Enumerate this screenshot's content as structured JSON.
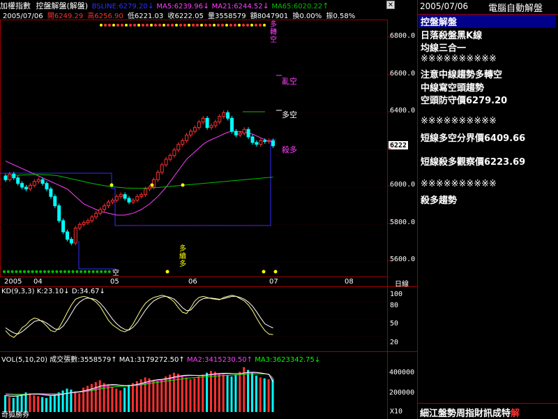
{
  "title": {
    "index_name": "加權指數",
    "mode": "控盤解盤(解盤)",
    "bsline_label": "BSLINE:6279.20",
    "ma5_label": "MA5:6239.96",
    "ma21_label": "MA21:6244.52",
    "ma65_label": "MA65:6020.22"
  },
  "info": {
    "date": "2005/07/06",
    "open": "開6249.29",
    "high": "高6256.90",
    "low": "低6221.03",
    "close": "收6222.05",
    "volume": "量3558579",
    "amount": "額8047901",
    "turnover": "換0.00%",
    "amplitude": "振0.58%"
  },
  "price_axis": {
    "ticks": [
      "6800.0",
      "6600.0",
      "6400.0",
      "6200.0",
      "6000.0",
      "5800.0",
      "5600.0"
    ],
    "current_price": "6222.0"
  },
  "time_axis": {
    "labels": [
      "2005",
      "04",
      "05",
      "06",
      "07",
      "08"
    ],
    "unit_button": "日線"
  },
  "annotations": {
    "bull_to_bear": "多轉空",
    "chaos_empty": "亂空",
    "bull_empty": "多空",
    "kill_bull": "殺多",
    "bull_holding": "多續多",
    "empty_mark": "空"
  },
  "kd": {
    "label": "KD(9,3,3)",
    "k_label": "K:23.10",
    "d_label": "D:34.67",
    "ticks": [
      "100",
      "80",
      "50",
      "20"
    ],
    "k_values": [
      30,
      22,
      18,
      25,
      35,
      40,
      48,
      52,
      50,
      45,
      38,
      30,
      28,
      35,
      48,
      62,
      75,
      85,
      88,
      90,
      88,
      85,
      80,
      72,
      60,
      48,
      40,
      35,
      30,
      28,
      32,
      42,
      55,
      68,
      78,
      84,
      88,
      90,
      92,
      90,
      86,
      80,
      70,
      62,
      60,
      70,
      82,
      88,
      90,
      88,
      86,
      85,
      84,
      88,
      90,
      92,
      90,
      86,
      82,
      75,
      65,
      52,
      40,
      30,
      24,
      23
    ],
    "d_values": [
      35,
      30,
      26,
      24,
      28,
      34,
      40,
      46,
      48,
      47,
      43,
      38,
      33,
      32,
      38,
      48,
      60,
      72,
      80,
      85,
      87,
      86,
      84,
      78,
      70,
      60,
      50,
      42,
      36,
      32,
      31,
      36,
      44,
      55,
      66,
      75,
      82,
      86,
      89,
      90,
      88,
      85,
      78,
      70,
      65,
      66,
      74,
      82,
      86,
      87,
      87,
      86,
      85,
      86,
      88,
      90,
      90,
      88,
      85,
      80,
      73,
      63,
      52,
      42,
      38,
      34.67
    ],
    "k_color": "#ffff80",
    "d_color": "#ffffff"
  },
  "volume": {
    "label": "VOL(5,10,20)",
    "shares_label": "成交張數:3558579",
    "ma1_label": "MA1:3179272.50",
    "ma2_label": "MA2:3415230.50",
    "ma3_label": "MA3:3623342.75",
    "ticks": [
      "400000",
      "200000"
    ],
    "multiplier": "X10",
    "values": [
      180000,
      160000,
      150000,
      170000,
      190000,
      210000,
      200000,
      180000,
      170000,
      160000,
      150000,
      170000,
      190000,
      210000,
      230000,
      250000,
      240000,
      220000,
      200000,
      260000,
      280000,
      300000,
      320000,
      340000,
      310000,
      290000,
      270000,
      250000,
      230000,
      260000,
      290000,
      310000,
      330000,
      350000,
      370000,
      360000,
      340000,
      330000,
      350000,
      380000,
      400000,
      420000,
      410000,
      390000,
      370000,
      350000,
      360000,
      380000,
      400000,
      420000,
      440000,
      430000,
      410000,
      400000,
      390000,
      380000,
      400000,
      430000,
      480000,
      450000,
      420000,
      390000,
      370000,
      360000,
      350000,
      356000
    ],
    "ma1": [
      175000,
      170000,
      168000,
      172000,
      178000,
      185000,
      190000,
      192000,
      190000,
      186000,
      180000,
      176000,
      178000,
      184000,
      192000,
      200000,
      208000,
      214000,
      218000,
      226000,
      236000,
      248000,
      262000,
      276000,
      286000,
      292000,
      294000,
      292000,
      286000,
      282000,
      282000,
      288000,
      296000,
      306000,
      318000,
      330000,
      340000,
      346000,
      350000,
      356000,
      364000,
      374000,
      384000,
      390000,
      394000,
      394000,
      392000,
      390000,
      392000,
      396000,
      402000,
      408000,
      412000,
      414000,
      414000,
      412000,
      410000,
      412000,
      418000,
      424000,
      426000,
      424000,
      418000,
      410000,
      400000,
      318000
    ],
    "ma2": [
      185000,
      182000,
      180000,
      180000,
      182000,
      186000,
      190000,
      192000,
      192000,
      190000,
      188000,
      186000,
      186000,
      188000,
      192000,
      198000,
      204000,
      210000,
      214000,
      220000,
      228000,
      238000,
      250000,
      262000,
      272000,
      280000,
      285000,
      287000,
      286000,
      284000,
      283000,
      285000,
      290000,
      298000,
      308000,
      318000,
      328000,
      336000,
      342000,
      348000,
      356000,
      364000,
      372000,
      380000,
      386000,
      390000,
      392000,
      392000,
      392000,
      394000,
      398000,
      402000,
      406000,
      408000,
      410000,
      410000,
      410000,
      410000,
      414000,
      418000,
      420000,
      420000,
      416000,
      410000,
      404000,
      341523
    ],
    "ma3": [
      195000,
      193000,
      191000,
      190000,
      190000,
      191000,
      193000,
      195000,
      196000,
      196000,
      195000,
      194000,
      194000,
      195000,
      197000,
      200000,
      204000,
      208000,
      212000,
      217000,
      223000,
      230000,
      238000,
      246000,
      254000,
      261000,
      267000,
      272000,
      275000,
      277000,
      279000,
      282000,
      286000,
      291000,
      297000,
      304000,
      311000,
      318000,
      324000,
      330000,
      336000,
      342000,
      348000,
      354000,
      360000,
      365000,
      369000,
      372000,
      375000,
      378000,
      381000,
      384000,
      387000,
      390000,
      393000,
      395000,
      397000,
      399000,
      402000,
      405000,
      407000,
      408000,
      408000,
      407000,
      405000,
      362334
    ]
  },
  "candles": {
    "opens": [
      6060,
      6040,
      6070,
      6050,
      6020,
      6000,
      5990,
      6010,
      6030,
      6040,
      6020,
      5990,
      5950,
      5900,
      5820,
      5760,
      5720,
      5700,
      5780,
      5800,
      5810,
      5820,
      5840,
      5860,
      5880,
      5900,
      5920,
      5930,
      5950,
      5960,
      5940,
      5920,
      5930,
      5950,
      5960,
      5990,
      6000,
      6040,
      6080,
      6120,
      6150,
      6170,
      6200,
      6230,
      6250,
      6280,
      6300,
      6320,
      6350,
      6370,
      6320,
      6330,
      6350,
      6380,
      6400,
      6370,
      6300,
      6280,
      6290,
      6310,
      6270,
      6240,
      6230,
      6250,
      6245,
      6249
    ],
    "closes": [
      6040,
      6070,
      6050,
      6020,
      6000,
      5990,
      6010,
      6030,
      6040,
      6020,
      5990,
      5950,
      5900,
      5820,
      5760,
      5720,
      5700,
      5780,
      5800,
      5810,
      5820,
      5840,
      5860,
      5880,
      5900,
      5920,
      5930,
      5950,
      5960,
      5940,
      5920,
      5930,
      5950,
      5960,
      5990,
      6000,
      6040,
      6080,
      6120,
      6150,
      6170,
      6200,
      6230,
      6250,
      6280,
      6300,
      6320,
      6350,
      6370,
      6320,
      6330,
      6350,
      6380,
      6400,
      6370,
      6300,
      6280,
      6290,
      6310,
      6270,
      6240,
      6230,
      6250,
      6245,
      6249,
      6222
    ]
  },
  "lines": {
    "bsline_color": "#3030ff",
    "ma_magenta": [
      6140,
      6130,
      6120,
      6110,
      6100,
      6090,
      6080,
      6070,
      6060,
      6050,
      6040,
      6030,
      6020,
      6010,
      6000,
      5990,
      5970,
      5950,
      5930,
      5910,
      5900,
      5890,
      5880,
      5870,
      5865,
      5860,
      5855,
      5850,
      5850,
      5850,
      5855,
      5860,
      5870,
      5880,
      5895,
      5910,
      5930,
      5950,
      5975,
      6000,
      6030,
      6060,
      6090,
      6120,
      6150,
      6170,
      6190,
      6210,
      6230,
      6245,
      6255,
      6265,
      6275,
      6285,
      6295,
      6300,
      6300,
      6298,
      6295,
      6290,
      6285,
      6275,
      6265,
      6255,
      6248,
      6244
    ],
    "ma_green": [
      6060,
      6062,
      6063,
      6064,
      6065,
      6066,
      6067,
      6068,
      6068,
      6067,
      6066,
      6065,
      6063,
      6060,
      6055,
      6050,
      6045,
      6040,
      6035,
      6030,
      6025,
      6020,
      6016,
      6012,
      6008,
      6005,
      6002,
      6000,
      5998,
      5996,
      5995,
      5994,
      5994,
      5994,
      5995,
      5996,
      5997,
      5998,
      6000,
      6002,
      6004,
      6006,
      6008,
      6010,
      6012,
      6014,
      6016,
      6018,
      6020,
      6022,
      6024,
      6026,
      6028,
      6030,
      6032,
      6034,
      6036,
      6038,
      6040,
      6042,
      6044,
      6046,
      6048,
      6050,
      6052,
      6054
    ]
  },
  "right_panel": {
    "date": "2005/07/06",
    "header": "電腦自動解盤",
    "line1": "控盤解盤",
    "line2": "日落殺盤黑K線",
    "line3": "均線三合一",
    "sep1": "※※※※※※※※※※",
    "line4": "注意中線趨勢多轉空",
    "line5": "中線寫空頭趨勢",
    "line6": "空頭防守價6279.20",
    "sep2": "※※※※※※※※※※",
    "line7": "短線多空分界價6409.66",
    "line8": "短線殺多觀察價6223.69",
    "sep3": "※※※※※※※※※※",
    "line9": "殺多趨勢",
    "footer_text": "細江盤勢周指財訊成特",
    "footer_highlight": "解"
  },
  "footer_left": "奇狐勝券",
  "colors": {
    "up": "#ff3030",
    "down": "#00ffff",
    "magenta": "#ff40ff",
    "green": "#00c000",
    "yellow": "#ffff00",
    "grid": "#a00000"
  }
}
